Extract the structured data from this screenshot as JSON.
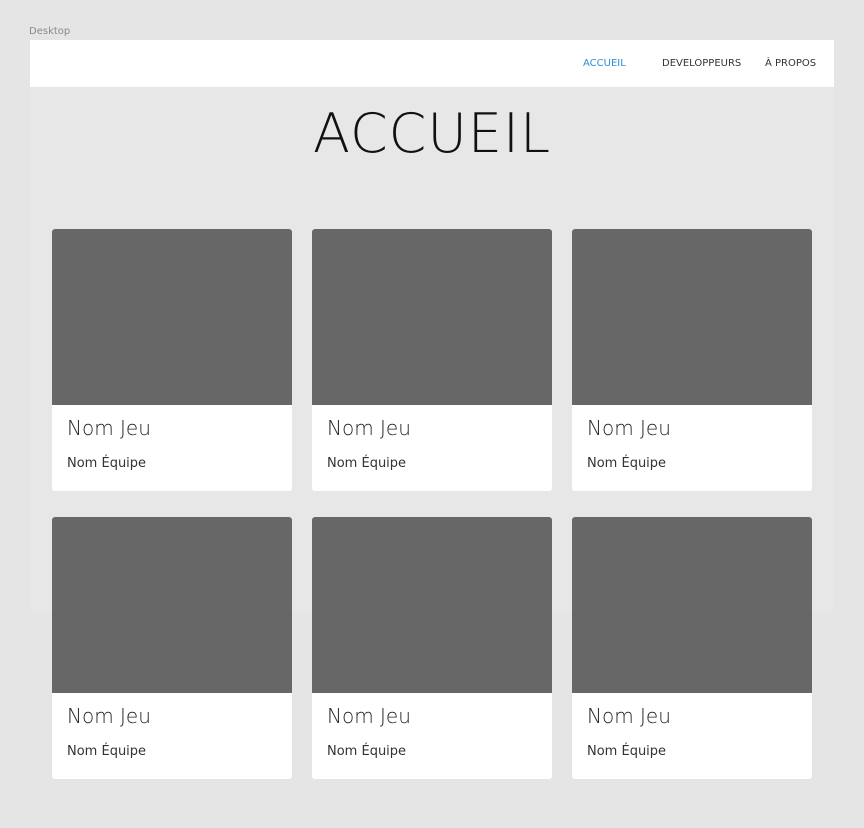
{
  "canvas": {
    "artboard_label": "Desktop"
  },
  "nav": {
    "items": [
      {
        "label": "ACCUEIL",
        "active": true
      },
      {
        "label": "DEVELOPPEURS",
        "active": false
      },
      {
        "label": "À PROPOS",
        "active": false
      }
    ]
  },
  "main": {
    "title": "ACCUEIL",
    "cards": [
      {
        "title": "Nom Jeu",
        "team": "Nom Équipe"
      },
      {
        "title": "Nom Jeu",
        "team": "Nom Équipe"
      },
      {
        "title": "Nom Jeu",
        "team": "Nom Équipe"
      },
      {
        "title": "Nom Jeu",
        "team": "Nom Équipe"
      },
      {
        "title": "Nom Jeu",
        "team": "Nom Équipe"
      },
      {
        "title": "Nom Jeu",
        "team": "Nom Équipe"
      }
    ]
  },
  "colors": {
    "accent": "#2a8fd8",
    "placeholder_image": "#676767",
    "background": "#e5e5e5",
    "card": "#ffffff"
  }
}
